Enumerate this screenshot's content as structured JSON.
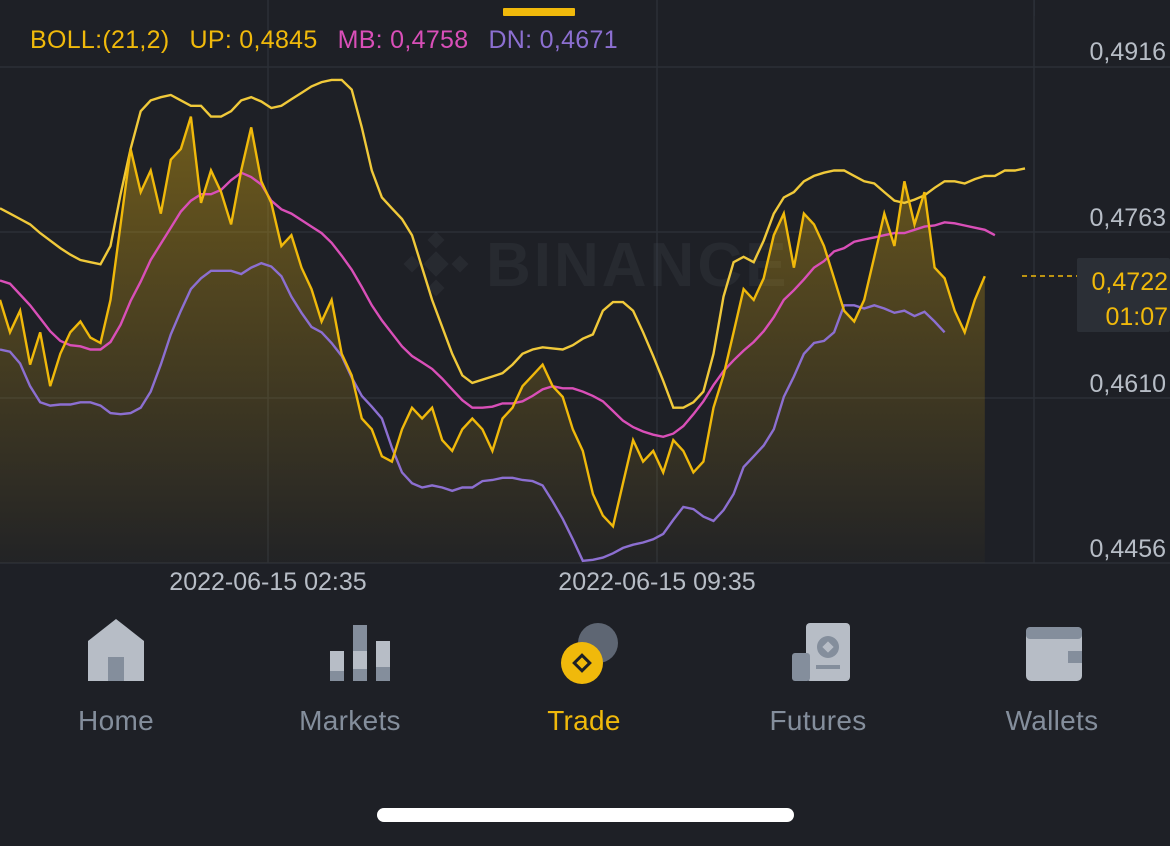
{
  "indicator": {
    "boll_label": "BOLL:(21,2)",
    "up": "UP: 0,4845",
    "mb": "MB: 0,4758",
    "dn": "DN: 0,4671"
  },
  "colors": {
    "price": "#f0b90b",
    "upper": "#f0c93a",
    "mid": "#d94fb8",
    "lower": "#8c6fd1",
    "grid": "#2b2f36",
    "axis_text": "#b7bdc6"
  },
  "axis": {
    "y_ticks": [
      "0,4916",
      "0,4763",
      "0,4610",
      "0,4456"
    ],
    "x_ticks": [
      "2022-06-15 02:35",
      "2022-06-15 09:35"
    ]
  },
  "current_price": {
    "value": "0,4722",
    "countdown": "01:07"
  },
  "watermark": "BINANCE",
  "chart_data": {
    "type": "line",
    "ylim": [
      0.4456,
      0.4916
    ],
    "x": [
      0,
      1,
      2,
      3,
      4,
      5,
      6,
      7,
      8,
      9,
      10,
      11,
      12,
      13,
      14,
      15,
      16,
      17,
      18,
      19,
      20,
      21,
      22,
      23,
      24,
      25,
      26,
      27,
      28,
      29,
      30,
      31,
      32,
      33,
      34,
      35,
      36,
      37,
      38,
      39,
      40,
      41,
      42,
      43,
      44,
      45,
      46,
      47,
      48,
      49,
      50,
      51,
      52,
      53,
      54,
      55,
      56,
      57,
      58,
      59,
      60,
      61,
      62,
      63,
      64,
      65,
      66,
      67,
      68,
      69,
      70,
      71,
      72,
      73,
      74,
      75,
      76,
      77,
      78,
      79,
      80,
      81,
      82,
      83,
      84,
      85,
      86,
      87,
      88,
      89,
      90,
      91,
      92,
      93,
      94,
      95,
      96,
      97,
      98,
      99,
      100,
      101,
      102
    ],
    "series": [
      {
        "name": "UP",
        "values": [
          0.4785,
          0.478,
          0.4775,
          0.477,
          0.4762,
          0.4755,
          0.4748,
          0.4742,
          0.4737,
          0.4735,
          0.4733,
          0.475,
          0.4798,
          0.484,
          0.4875,
          0.4885,
          0.4888,
          0.489,
          0.4885,
          0.488,
          0.488,
          0.487,
          0.487,
          0.4875,
          0.4885,
          0.4888,
          0.4884,
          0.4878,
          0.488,
          0.4886,
          0.4892,
          0.4898,
          0.4902,
          0.4904,
          0.4904,
          0.4895,
          0.486,
          0.482,
          0.4795,
          0.4785,
          0.4775,
          0.476,
          0.473,
          0.47,
          0.4675,
          0.465,
          0.463,
          0.4623,
          0.4626,
          0.4629,
          0.4632,
          0.464,
          0.465,
          0.4654,
          0.4656,
          0.4655,
          0.4654,
          0.4658,
          0.4664,
          0.4668,
          0.469,
          0.4698,
          0.4698,
          0.469,
          0.467,
          0.4648,
          0.4625,
          0.46,
          0.46,
          0.4605,
          0.4615,
          0.465,
          0.4703,
          0.4735,
          0.474,
          0.4735,
          0.4755,
          0.478,
          0.4795,
          0.48,
          0.481,
          0.4815,
          0.4818,
          0.482,
          0.482,
          0.4815,
          0.481,
          0.4808,
          0.48,
          0.4792,
          0.479,
          0.4793,
          0.4797,
          0.4804,
          0.481,
          0.481,
          0.4808,
          0.4812,
          0.4815,
          0.4815,
          0.482,
          0.482,
          0.4822
        ]
      },
      {
        "name": "MB",
        "values": [
          0.4718,
          0.4715,
          0.4705,
          0.4695,
          0.4683,
          0.4671,
          0.4662,
          0.4658,
          0.4657,
          0.4654,
          0.4654,
          0.4661,
          0.4677,
          0.4699,
          0.4717,
          0.4737,
          0.4752,
          0.4767,
          0.4782,
          0.4792,
          0.4798,
          0.4798,
          0.4802,
          0.4811,
          0.4818,
          0.4814,
          0.4807,
          0.4792,
          0.4784,
          0.478,
          0.4774,
          0.4768,
          0.4762,
          0.4753,
          0.4741,
          0.4728,
          0.4712,
          0.4695,
          0.4681,
          0.4669,
          0.4657,
          0.4648,
          0.4642,
          0.4636,
          0.4627,
          0.4617,
          0.4607,
          0.46,
          0.46,
          0.4601,
          0.4604,
          0.4604,
          0.4606,
          0.4611,
          0.4617,
          0.462,
          0.4618,
          0.4618,
          0.4615,
          0.4611,
          0.4606,
          0.4597,
          0.4588,
          0.4582,
          0.4578,
          0.4575,
          0.4573,
          0.4576,
          0.4583,
          0.4594,
          0.4606,
          0.4621,
          0.4634,
          0.4644,
          0.4653,
          0.4661,
          0.4671,
          0.4684,
          0.47,
          0.4709,
          0.4719,
          0.473,
          0.4736,
          0.4745,
          0.4748,
          0.4754,
          0.4756,
          0.4758,
          0.476,
          0.4762,
          0.4762,
          0.4765,
          0.4768,
          0.4769,
          0.4772,
          0.4771,
          0.4769,
          0.4767,
          0.4765,
          0.476
        ]
      },
      {
        "name": "DN",
        "values": [
          0.4654,
          0.4652,
          0.4641,
          0.462,
          0.4605,
          0.4602,
          0.4603,
          0.4603,
          0.4605,
          0.4605,
          0.4602,
          0.4595,
          0.4594,
          0.4595,
          0.46,
          0.4615,
          0.464,
          0.4668,
          0.469,
          0.471,
          0.472,
          0.4727,
          0.4727,
          0.4727,
          0.4724,
          0.473,
          0.4734,
          0.4731,
          0.4722,
          0.4703,
          0.4688,
          0.4675,
          0.467,
          0.466,
          0.4648,
          0.4628,
          0.4611,
          0.4601,
          0.459,
          0.4563,
          0.454,
          0.453,
          0.4526,
          0.4528,
          0.4526,
          0.4523,
          0.4526,
          0.4526,
          0.4532,
          0.4533,
          0.4535,
          0.4535,
          0.4533,
          0.4532,
          0.4528,
          0.4513,
          0.4497,
          0.4478,
          0.4458,
          0.4459,
          0.4461,
          0.4465,
          0.447,
          0.4473,
          0.4475,
          0.4478,
          0.4483,
          0.4496,
          0.4508,
          0.4506,
          0.4499,
          0.4495,
          0.4505,
          0.452,
          0.4545,
          0.4555,
          0.4565,
          0.458,
          0.461,
          0.4629,
          0.465,
          0.466,
          0.4662,
          0.467,
          0.4695,
          0.4695,
          0.4692,
          0.4695,
          0.4692,
          0.4688,
          0.469,
          0.4685,
          0.4689,
          0.468,
          0.467
        ]
      },
      {
        "name": "Price",
        "values": [
          0.47,
          0.467,
          0.469,
          0.464,
          0.467,
          0.462,
          0.465,
          0.467,
          0.468,
          0.4665,
          0.466,
          0.47,
          0.477,
          0.484,
          0.48,
          0.482,
          0.478,
          0.483,
          0.484,
          0.487,
          0.479,
          0.482,
          0.48,
          0.477,
          0.482,
          0.486,
          0.481,
          0.479,
          0.475,
          0.476,
          0.473,
          0.471,
          0.468,
          0.47,
          0.465,
          0.463,
          0.459,
          0.458,
          0.4555,
          0.455,
          0.458,
          0.46,
          0.459,
          0.46,
          0.457,
          0.456,
          0.458,
          0.459,
          0.458,
          0.456,
          0.459,
          0.46,
          0.462,
          0.463,
          0.464,
          0.462,
          0.461,
          0.458,
          0.456,
          0.452,
          0.45,
          0.449,
          0.453,
          0.457,
          0.455,
          0.456,
          0.454,
          0.457,
          0.456,
          0.454,
          0.455,
          0.46,
          0.463,
          0.467,
          0.471,
          0.47,
          0.472,
          0.476,
          0.478,
          0.473,
          0.478,
          0.477,
          0.475,
          0.472,
          0.469,
          0.468,
          0.47,
          0.474,
          0.478,
          0.475,
          0.481,
          0.477,
          0.48,
          0.473,
          0.472,
          0.469,
          0.467,
          0.47,
          0.4722
        ]
      }
    ]
  },
  "nav": {
    "items": [
      {
        "label": "Home",
        "icon": "home-icon"
      },
      {
        "label": "Markets",
        "icon": "markets-icon"
      },
      {
        "label": "Trade",
        "icon": "trade-icon"
      },
      {
        "label": "Futures",
        "icon": "futures-icon"
      },
      {
        "label": "Wallets",
        "icon": "wallets-icon"
      }
    ],
    "active": "Trade"
  }
}
